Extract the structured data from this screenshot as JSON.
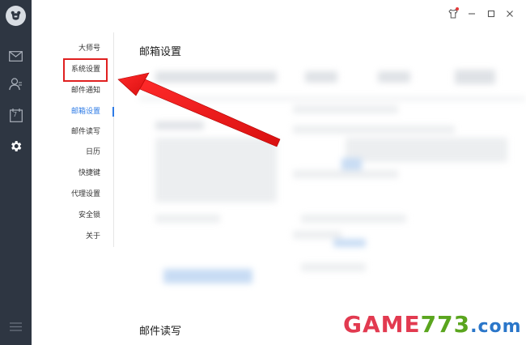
{
  "window": {
    "buttons": {
      "skin_icon": "shirt-icon",
      "minimize_label": "—",
      "maximize_label": "□",
      "close_label": "✕"
    }
  },
  "rail": {
    "items": [
      {
        "name": "mail",
        "icon": "mail-icon"
      },
      {
        "name": "contacts",
        "icon": "contacts-icon"
      },
      {
        "name": "calendar",
        "icon": "calendar-icon",
        "text": "7"
      },
      {
        "name": "settings",
        "icon": "gear-icon"
      },
      {
        "name": "menu",
        "icon": "hamburger-icon"
      }
    ]
  },
  "nav": {
    "items": [
      {
        "label": "大师号"
      },
      {
        "label": "系统设置"
      },
      {
        "label": "邮件通知"
      },
      {
        "label": "邮箱设置",
        "active": true
      },
      {
        "label": "邮件读写"
      },
      {
        "label": "日历"
      },
      {
        "label": "快捷键"
      },
      {
        "label": "代理设置"
      },
      {
        "label": "安全锁"
      },
      {
        "label": "关于"
      }
    ]
  },
  "content": {
    "section1_title": "邮箱设置",
    "section2_title": "邮件读写"
  },
  "watermark": {
    "part1": "GAME",
    "part2": "773",
    "part3": ".com"
  },
  "colors": {
    "rail_bg": "#2e3642",
    "accent": "#2e7be6",
    "highlight": "#e02020"
  }
}
